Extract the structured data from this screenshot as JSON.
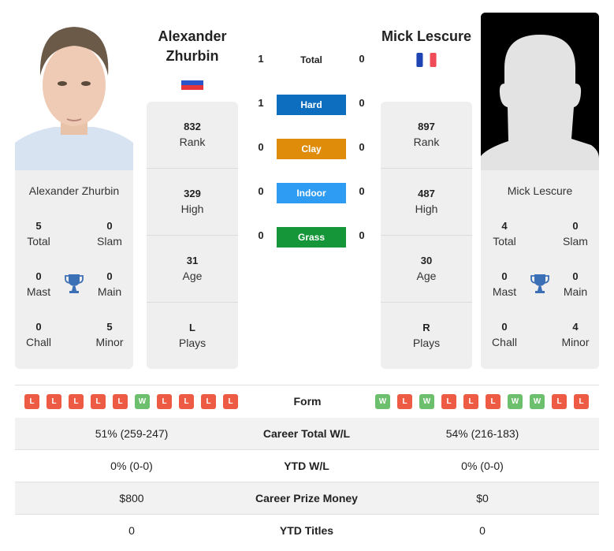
{
  "player_left": {
    "name": "Alexander Zhurbin",
    "name_line1": "Alexander",
    "name_line2": "Zhurbin",
    "country_flag": "russia-flag",
    "rank": "832",
    "rank_label": "Rank",
    "high": "329",
    "high_label": "High",
    "age": "31",
    "age_label": "Age",
    "plays": "L",
    "plays_label": "Plays",
    "titles": {
      "total": "5",
      "total_label": "Total",
      "slam": "0",
      "slam_label": "Slam",
      "mast": "0",
      "mast_label": "Mast",
      "main": "0",
      "main_label": "Main",
      "chall": "0",
      "chall_label": "Chall",
      "minor": "5",
      "minor_label": "Minor"
    },
    "form": [
      "L",
      "L",
      "L",
      "L",
      "L",
      "W",
      "L",
      "L",
      "L",
      "L"
    ]
  },
  "player_right": {
    "name": "Mick Lescure",
    "country_flag": "france-flag",
    "rank": "897",
    "rank_label": "Rank",
    "high": "487",
    "high_label": "High",
    "age": "30",
    "age_label": "Age",
    "plays": "R",
    "plays_label": "Plays",
    "titles": {
      "total": "4",
      "total_label": "Total",
      "slam": "0",
      "slam_label": "Slam",
      "mast": "0",
      "mast_label": "Mast",
      "main": "0",
      "main_label": "Main",
      "chall": "0",
      "chall_label": "Chall",
      "minor": "4",
      "minor_label": "Minor"
    },
    "form": [
      "W",
      "L",
      "W",
      "L",
      "L",
      "L",
      "W",
      "W",
      "L",
      "L"
    ]
  },
  "h2h": {
    "total": {
      "label": "Total",
      "left": "1",
      "right": "0"
    },
    "surfaces": [
      {
        "label": "Hard",
        "left": "1",
        "right": "0",
        "color": "#0d6ebf"
      },
      {
        "label": "Clay",
        "left": "0",
        "right": "0",
        "color": "#de8c0a"
      },
      {
        "label": "Indoor",
        "left": "0",
        "right": "0",
        "color": "#2e9cf2"
      },
      {
        "label": "Grass",
        "left": "0",
        "right": "0",
        "color": "#149639"
      }
    ]
  },
  "form_label": "Form",
  "comparison": [
    {
      "label": "Career Total W/L",
      "left": "51% (259-247)",
      "right": "54% (216-183)"
    },
    {
      "label": "YTD W/L",
      "left": "0% (0-0)",
      "right": "0% (0-0)"
    },
    {
      "label": "Career Prize Money",
      "left": "$800",
      "right": "$0"
    },
    {
      "label": "YTD Titles",
      "left": "0",
      "right": "0"
    }
  ],
  "colors": {
    "win": "#6cbf6c",
    "loss": "#ee5b45",
    "trophy": "#3b6fb6"
  }
}
